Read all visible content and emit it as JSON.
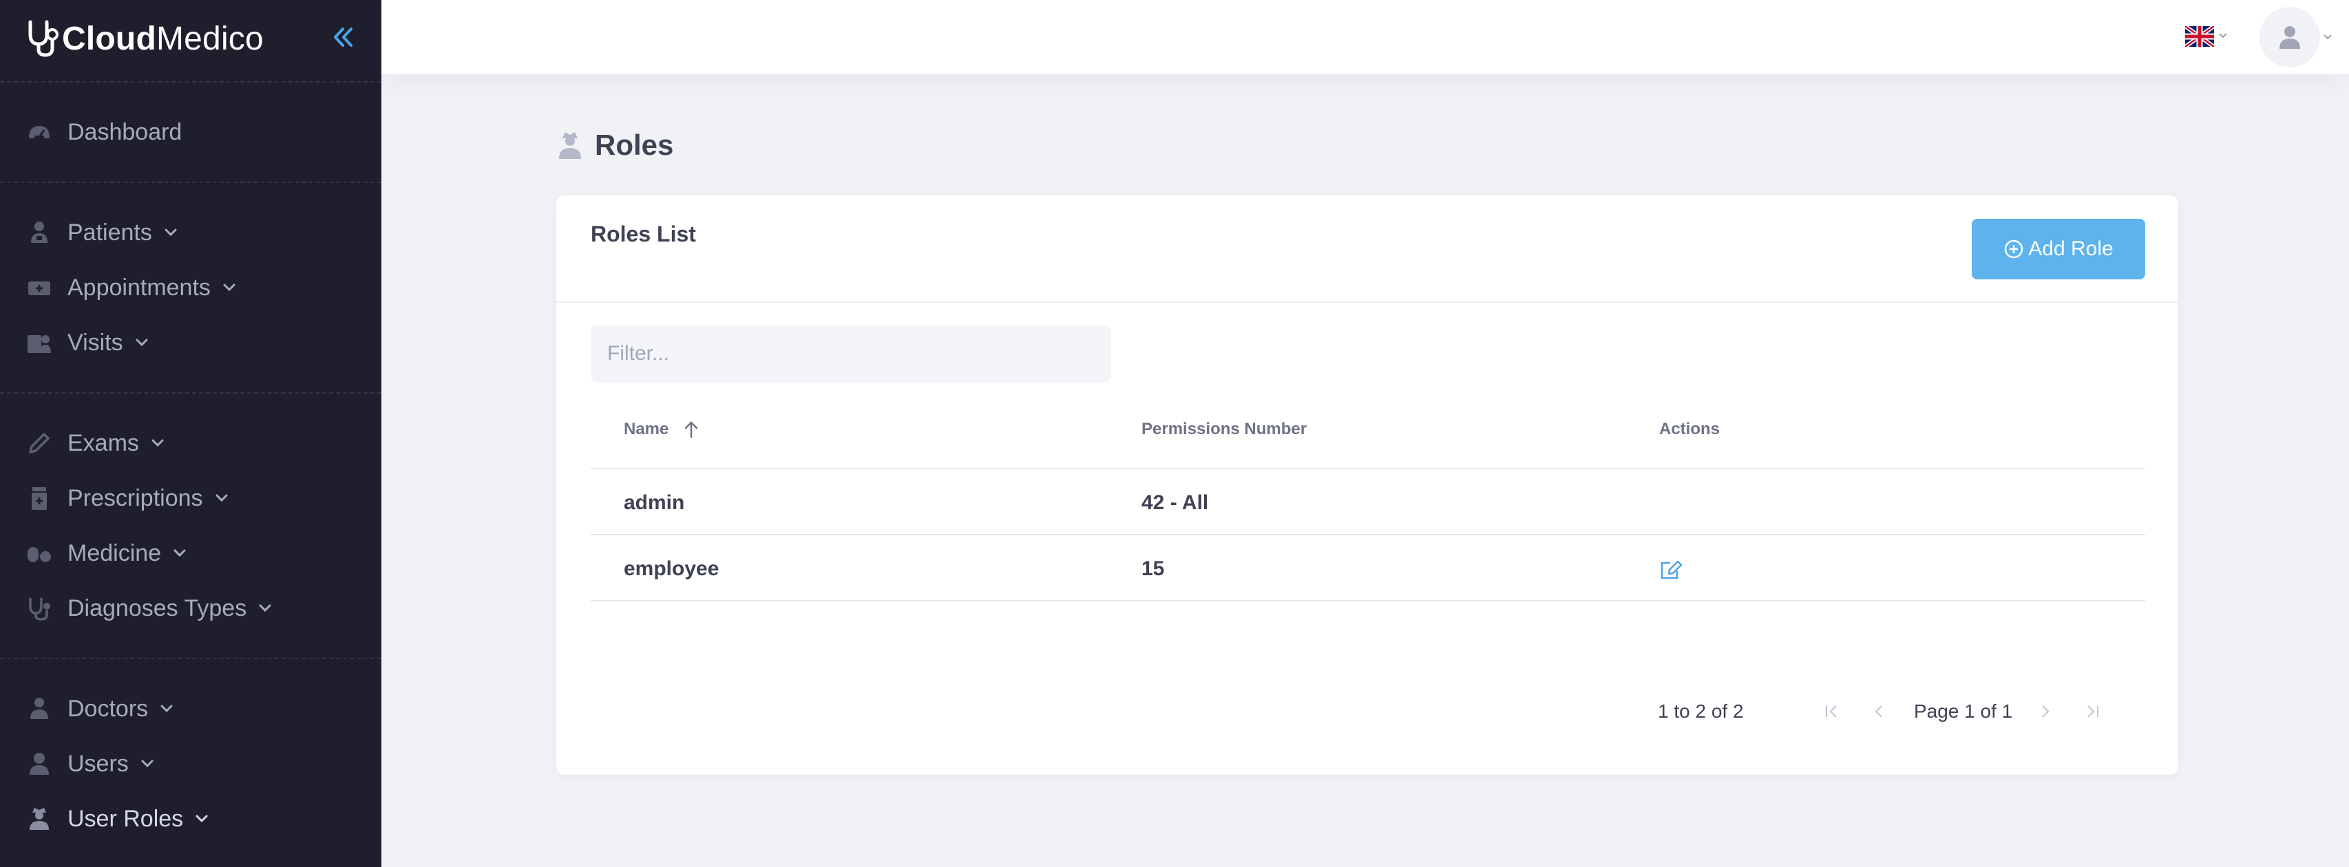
{
  "brand": {
    "bold": "Cloud",
    "light": "Medico",
    "icon": "stethoscope-icon"
  },
  "sidebar": {
    "items": [
      {
        "label": "Dashboard",
        "icon": "dashboard-icon",
        "dropdown": false
      },
      {
        "label": "Patients",
        "icon": "patient-icon",
        "dropdown": true
      },
      {
        "label": "Appointments",
        "icon": "appointment-icon",
        "dropdown": true
      },
      {
        "label": "Visits",
        "icon": "visits-icon",
        "dropdown": true
      },
      {
        "label": "Exams",
        "icon": "pen-icon",
        "dropdown": true
      },
      {
        "label": "Prescriptions",
        "icon": "prescription-icon",
        "dropdown": true
      },
      {
        "label": "Medicine",
        "icon": "pills-icon",
        "dropdown": true
      },
      {
        "label": "Diagnoses Types",
        "icon": "stethoscope-icon",
        "dropdown": true
      },
      {
        "label": "Doctors",
        "icon": "doctor-icon",
        "dropdown": true
      },
      {
        "label": "Users",
        "icon": "user-icon",
        "dropdown": true
      },
      {
        "label": "User Roles",
        "icon": "user-secret-icon",
        "dropdown": true
      }
    ]
  },
  "header": {
    "language_flag": "uk-flag-icon"
  },
  "page": {
    "title": "Roles"
  },
  "card": {
    "title": "Roles List",
    "add_button_label": "Add Role",
    "filter_placeholder": "Filter...",
    "columns": [
      "Name",
      "Permissions Number",
      "Actions"
    ],
    "rows": [
      {
        "name": "admin",
        "permissions": "42 - All",
        "editable": false
      },
      {
        "name": "employee",
        "permissions": "15",
        "editable": true
      }
    ],
    "pagination": {
      "summary": "1 to 2 of 2",
      "page_label": "Page 1 of 1"
    }
  },
  "colors": {
    "sidebar_bg": "#1e1e2d",
    "accent": "#5eb3ec",
    "page_bg": "#f1f2f5"
  }
}
